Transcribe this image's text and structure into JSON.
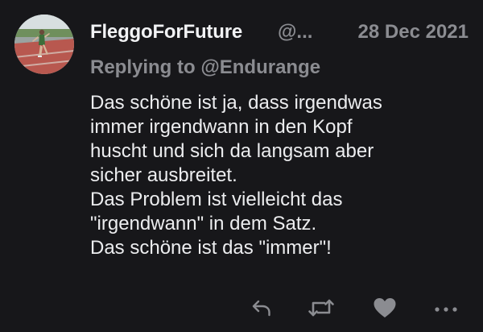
{
  "author": {
    "display_name": "FleggoForFuture",
    "handle": "@...",
    "date": "28 Dec 2021"
  },
  "reply": {
    "text": "Replying to @Endurange"
  },
  "body": {
    "lines": [
      "Das schöne ist ja, dass irgendwas",
      "immer irgendwann in den Kopf",
      "huscht und sich da langsam aber",
      "sicher ausbreitet.",
      "Das Problem ist vielleicht das",
      "\"irgendwann\" in dem Satz.",
      "Das schöne ist das \"immer\"!"
    ]
  },
  "actions": {
    "reply_icon": "reply-arrow",
    "retweet_icon": "retweet-arrows",
    "like_icon": "heart",
    "more_icon": "ellipsis"
  },
  "colors": {
    "background": "#17171a",
    "text": "#ecedef",
    "muted": "#8b8c91"
  }
}
